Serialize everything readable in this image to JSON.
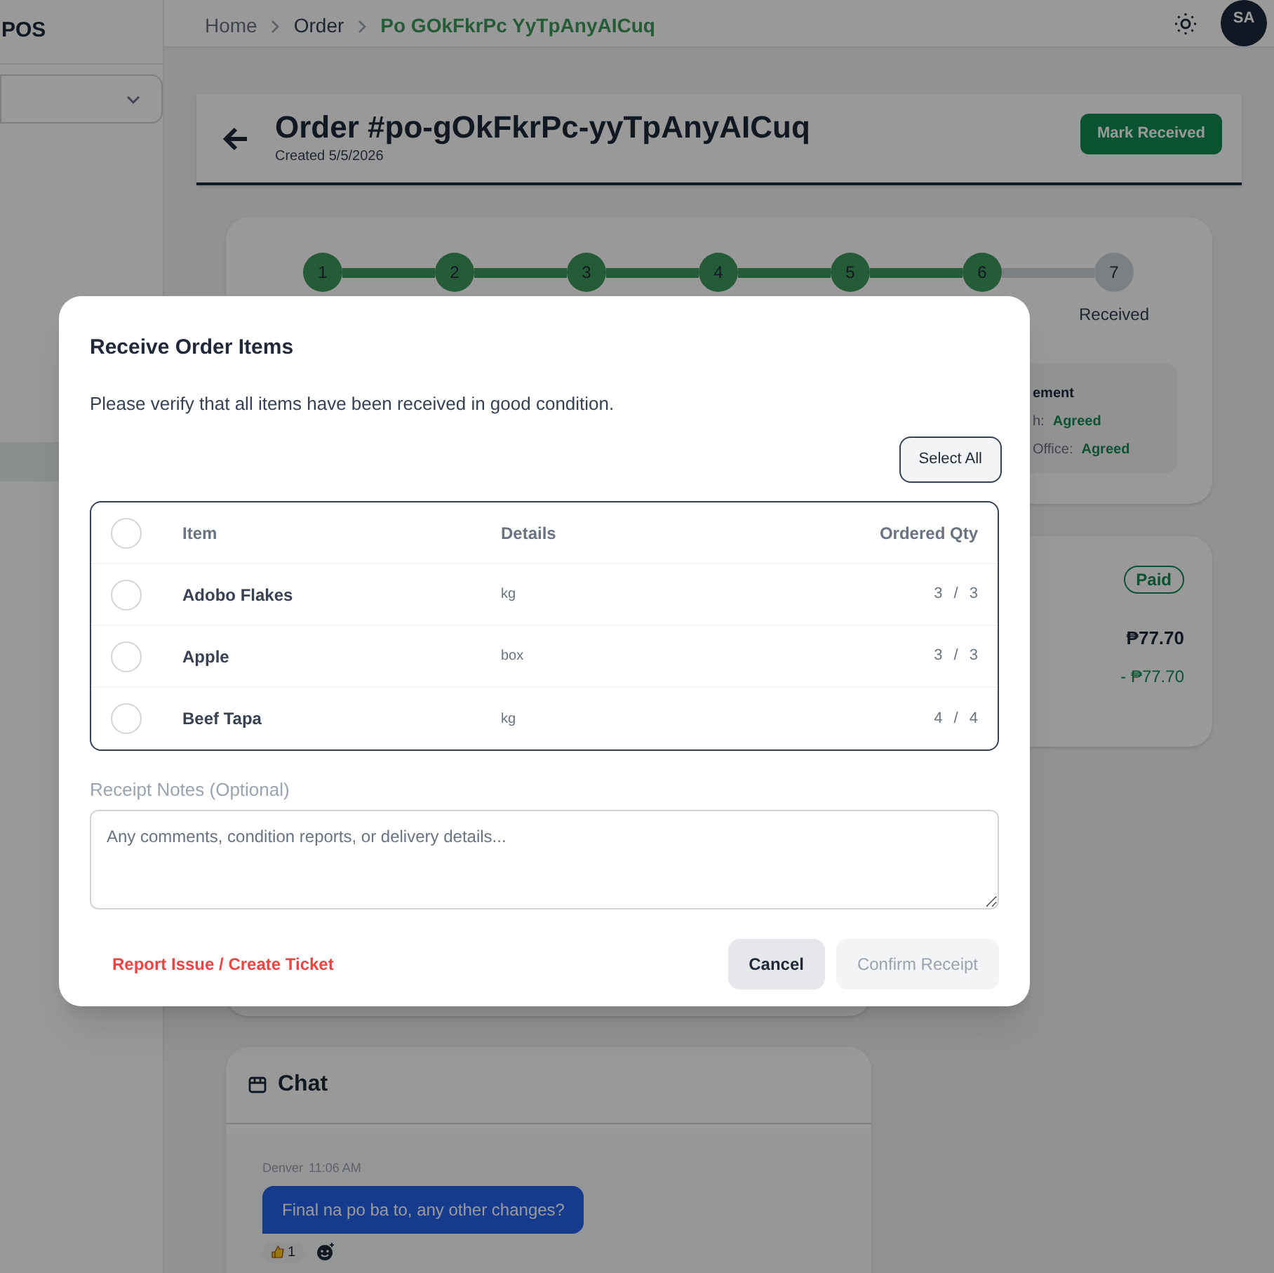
{
  "sidebar": {
    "brand": "POS"
  },
  "breadcrumbs": [
    {
      "label": "Home",
      "current": false
    },
    {
      "label": "Order",
      "current": false
    },
    {
      "label": "Po GOkFkrPc YyTpAnyAICuq",
      "current": true
    }
  ],
  "user": {
    "initials": "SA"
  },
  "order": {
    "title": "Order #po-gOkFkrPc-yyTpAnyAICuq",
    "created": "Created 5/5/2026",
    "action": "Mark Received"
  },
  "progress": {
    "steps": [
      {
        "number": "1",
        "done": true
      },
      {
        "number": "2",
        "done": true
      },
      {
        "number": "3",
        "done": true
      },
      {
        "number": "4",
        "done": true
      },
      {
        "number": "5",
        "done": true
      },
      {
        "number": "6",
        "done": true
      },
      {
        "number": "7",
        "done": false,
        "label": "Received"
      }
    ]
  },
  "agreement": {
    "heading": "ement",
    "rows": [
      {
        "label": "h:",
        "value": "Agreed"
      },
      {
        "label": "Office:",
        "value": "Agreed"
      }
    ]
  },
  "payment": {
    "status": "Paid",
    "total": "₱77.70",
    "paid": "- ₱77.70"
  },
  "chat": {
    "title": "Chat",
    "messages": [
      {
        "author": "Denver",
        "time": "11:06 AM",
        "text": "Final na po ba to, any other changes?",
        "reactions": [
          {
            "count": "1"
          }
        ]
      }
    ]
  },
  "modal": {
    "title": "Receive Order Items",
    "description": "Please verify that all items have been received in good condition.",
    "select_all": "Select All",
    "header_checked": false,
    "columns": [
      "Item",
      "Details",
      "Ordered Qty"
    ],
    "rows": [
      {
        "item": "Adobo Flakes",
        "details": "kg",
        "qty": "3 / 3",
        "checked": false
      },
      {
        "item": "Apple",
        "details": "box",
        "qty": "3 / 3",
        "checked": false
      },
      {
        "item": "Beef Tapa",
        "details": "kg",
        "qty": "4 / 4",
        "checked": false
      }
    ],
    "notes_label": "Receipt Notes (Optional)",
    "notes_placeholder": "Any comments, condition reports, or delivery details...",
    "report_link": "Report Issue / Create Ticket",
    "cancel": "Cancel",
    "confirm": {
      "label": "Confirm Receipt",
      "disabled": true
    }
  }
}
